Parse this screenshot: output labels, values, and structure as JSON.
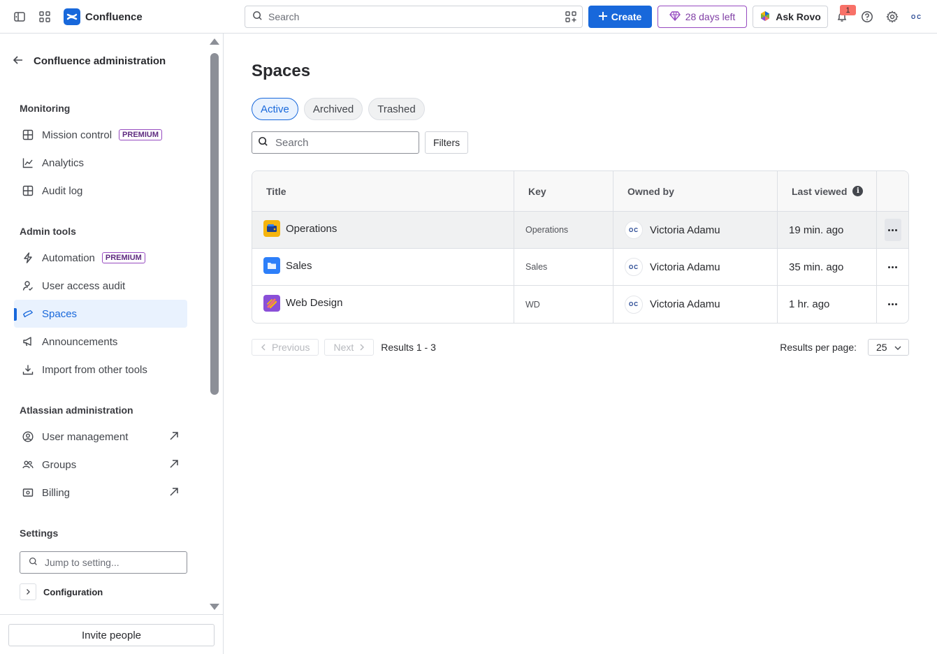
{
  "topbar": {
    "app_name": "Confluence",
    "search_placeholder": "Search",
    "create_label": "Create",
    "trial_label": "28 days left",
    "rovo_label": "Ask Rovo",
    "notification_count": "1",
    "avatar_initials": "OC"
  },
  "sidebar": {
    "back_title": "Confluence administration",
    "sections": {
      "monitoring": "Monitoring",
      "admin_tools": "Admin tools",
      "atlassian_admin": "Atlassian administration",
      "settings": "Settings"
    },
    "items": {
      "mission_control": "Mission control",
      "analytics": "Analytics",
      "audit_log": "Audit log",
      "automation": "Automation",
      "user_access_audit": "User access audit",
      "spaces": "Spaces",
      "announcements": "Announcements",
      "import": "Import from other tools",
      "user_management": "User management",
      "groups": "Groups",
      "billing": "Billing"
    },
    "premium_badge": "PREMIUM",
    "jump_placeholder": "Jump to setting...",
    "configuration": "Configuration",
    "invite_label": "Invite people"
  },
  "main": {
    "title": "Spaces",
    "tabs": [
      "Active",
      "Archived",
      "Trashed"
    ],
    "search_placeholder": "Search",
    "filters_label": "Filters",
    "columns": [
      "Title",
      "Key",
      "Owned by",
      "Last viewed"
    ],
    "rows": [
      {
        "title": "Operations",
        "key": "Operations",
        "owner": "Victoria Adamu",
        "owner_initials": "OC",
        "last_viewed": "19 min. ago",
        "icon_color": "#f5b40e"
      },
      {
        "title": "Sales",
        "key": "Sales",
        "owner": "Victoria Adamu",
        "owner_initials": "OC",
        "last_viewed": "35 min. ago",
        "icon_color": "#2d7ff9"
      },
      {
        "title": "Web Design",
        "key": "WD",
        "owner": "Victoria Adamu",
        "owner_initials": "OC",
        "last_viewed": "1 hr. ago",
        "icon_color": "#8a4fd8"
      }
    ],
    "pagination": {
      "previous": "Previous",
      "next": "Next",
      "results": "Results 1 - 3",
      "per_page_label": "Results per page:",
      "per_page_value": "25"
    }
  },
  "colors": {
    "accent": "#1868db",
    "premium": "#964ac0"
  }
}
